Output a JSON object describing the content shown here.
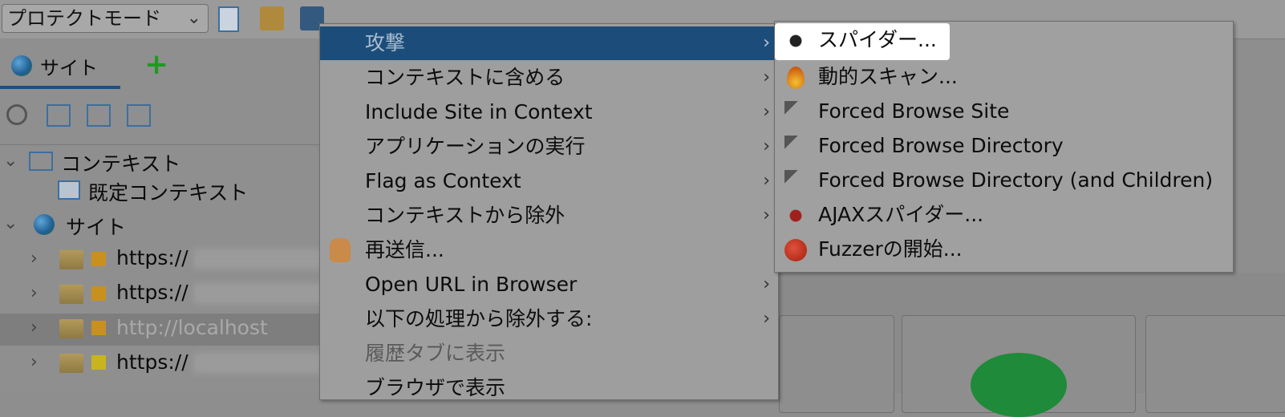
{
  "toolbar": {
    "mode_select": {
      "value": "プロテクトモード",
      "icon": "chevron-down-icon"
    }
  },
  "sites_panel": {
    "tab_label": "サイト",
    "add_icon": "plus-icon",
    "tree": {
      "contexts_label": "コンテキスト",
      "default_context_label": "既定コンテキスト",
      "sites_label": "サイト",
      "rows": [
        {
          "prefix": "https://"
        },
        {
          "prefix": "https://"
        },
        {
          "prefix": "http://localhost"
        },
        {
          "prefix": "https://"
        }
      ]
    }
  },
  "context_menu": {
    "items": [
      {
        "label": "攻撃",
        "submenu": true,
        "selected": true
      },
      {
        "label": "コンテキストに含める",
        "submenu": true
      },
      {
        "label": "Include Site in Context",
        "submenu": true
      },
      {
        "label": "アプリケーションの実行",
        "submenu": true
      },
      {
        "label": "Flag as Context",
        "submenu": true
      },
      {
        "label": "コンテキストから除外",
        "submenu": true
      },
      {
        "label": "再送信...",
        "submenu": false,
        "icon": "hand-icon"
      },
      {
        "label": "Open URL in Browser",
        "submenu": true
      },
      {
        "label": "以下の処理から除外する:",
        "submenu": true
      },
      {
        "label": "履歴タブに表示",
        "submenu": false,
        "disabled": true
      },
      {
        "label": "ブラウザで表示",
        "submenu": false
      }
    ]
  },
  "attack_submenu": {
    "items": [
      {
        "label": "スパイダー...",
        "icon": "spider-icon"
      },
      {
        "label": "動的スキャン...",
        "icon": "flame-icon"
      },
      {
        "label": "Forced Browse Site",
        "icon": "hammer-icon"
      },
      {
        "label": "Forced Browse Directory",
        "icon": "hammer-icon"
      },
      {
        "label": "Forced Browse Directory (and Children)",
        "icon": "hammer-icon"
      },
      {
        "label": "AJAXスパイダー...",
        "icon": "red-spider-icon"
      },
      {
        "label": "Fuzzerの開始...",
        "icon": "fuzzer-icon"
      }
    ]
  },
  "colors": {
    "menu_selection": "#1c4d7a",
    "dim_background": "#8e8e8e"
  }
}
